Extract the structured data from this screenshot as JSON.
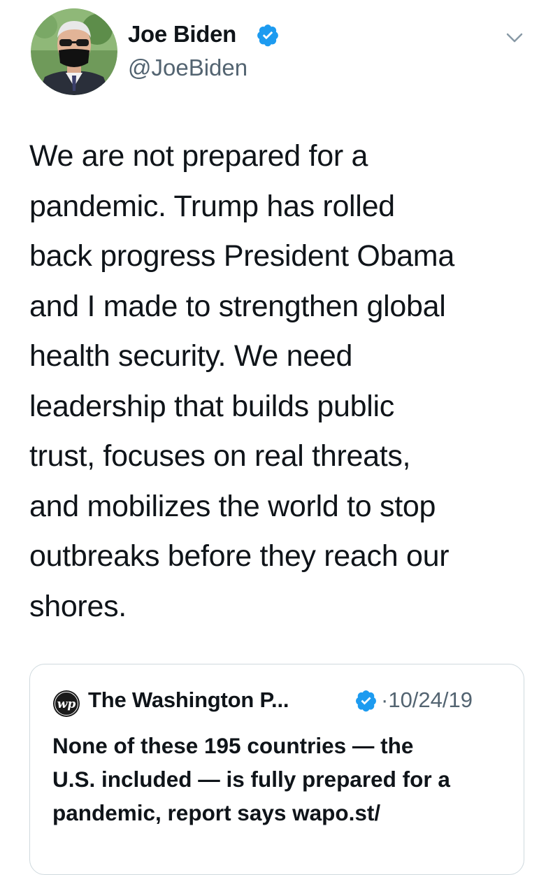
{
  "author": {
    "name": "Joe Biden",
    "handle": "@JoeBiden",
    "verified": true,
    "avatar": "profile-photo"
  },
  "menu": {
    "icon": "chevron-down-icon"
  },
  "tweet": {
    "lines": [
      "We are not prepared for a",
      "pandemic. Trump has rolled",
      "back progress President Obama",
      "and I made to strengthen global",
      "health security. We need",
      "leadership that builds public",
      "trust, focuses on real threats,",
      "and mobilizes the world to stop",
      "outbreaks before they reach our",
      "shores."
    ]
  },
  "quoted_tweet": {
    "logo": "wp-logo-icon",
    "logo_text": "wp",
    "name": "The Washington P...",
    "verified": true,
    "date": "·10/24/19",
    "lines": [
      "None of these 195 countries — the",
      "U.S. included — is fully prepared for a",
      "pandemic, report says wapo.st/"
    ]
  },
  "colors": {
    "text": "#0f1419",
    "secondary": "#536471",
    "verified": "#1d9bf0",
    "border": "#cfd9de"
  }
}
